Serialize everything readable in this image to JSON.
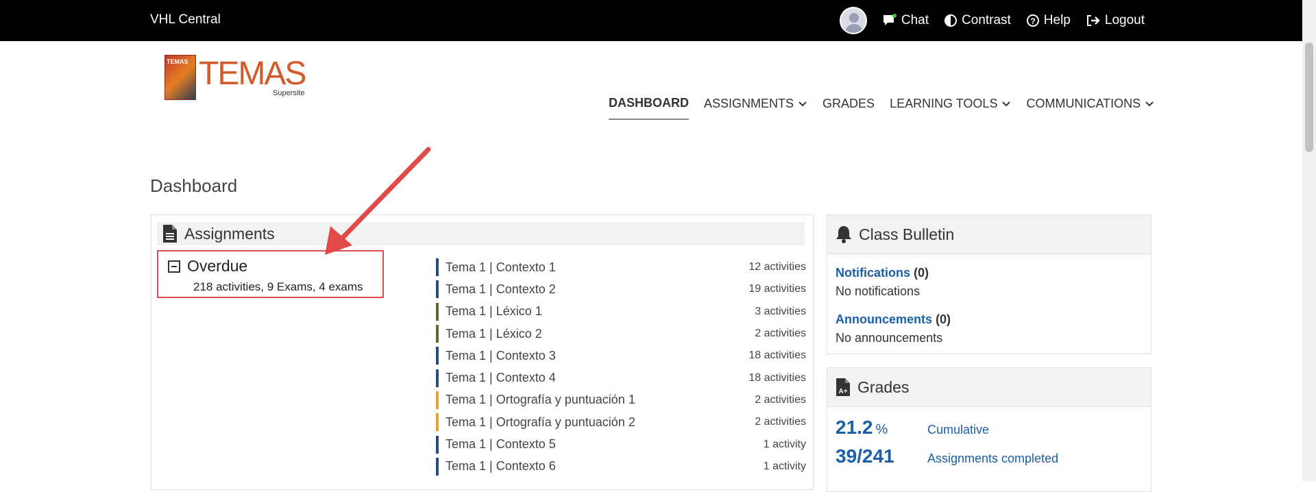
{
  "header": {
    "brand": "VHL Central",
    "nav": [
      {
        "label": "Chat",
        "icon": "chat-icon"
      },
      {
        "label": "Contrast",
        "icon": "contrast-icon"
      },
      {
        "label": "Help",
        "icon": "help-icon"
      },
      {
        "label": "Logout",
        "icon": "logout-icon"
      }
    ]
  },
  "logo": {
    "word": "TEMAS",
    "book_text": "TEMAS",
    "sub": "Supersite"
  },
  "main_nav": [
    {
      "label": "DASHBOARD",
      "active": true,
      "dropdown": false
    },
    {
      "label": "ASSIGNMENTS",
      "active": false,
      "dropdown": true
    },
    {
      "label": "GRADES",
      "active": false,
      "dropdown": false
    },
    {
      "label": "LEARNING TOOLS",
      "active": false,
      "dropdown": true
    },
    {
      "label": "COMMUNICATIONS",
      "active": false,
      "dropdown": true
    }
  ],
  "page_title": "Dashboard",
  "assignments": {
    "title": "Assignments",
    "overdue": {
      "title": "Overdue",
      "summary": "218 activities, 9 Exams, 4 exams"
    },
    "items": [
      {
        "name": "Tema 1 | Contexto 1",
        "count": "12 activities",
        "color": "#2a4a80"
      },
      {
        "name": "Tema 1 | Contexto 2",
        "count": "19 activities",
        "color": "#2a4a80"
      },
      {
        "name": "Tema 1 | Léxico 1",
        "count": "3 activities",
        "color": "#5a6e2a"
      },
      {
        "name": "Tema 1 | Léxico 2",
        "count": "2 activities",
        "color": "#5a6e2a"
      },
      {
        "name": "Tema 1 | Contexto 3",
        "count": "18 activities",
        "color": "#2a4a80"
      },
      {
        "name": "Tema 1 | Contexto 4",
        "count": "18 activities",
        "color": "#2a4a80"
      },
      {
        "name": "Tema 1 | Ortografía y puntuación 1",
        "count": "2 activities",
        "color": "#f0a030"
      },
      {
        "name": "Tema 1 | Ortografía y puntuación 2",
        "count": "2 activities",
        "color": "#f0a030"
      },
      {
        "name": "Tema 1 | Contexto 5",
        "count": "1 activity",
        "color": "#2a4a80"
      },
      {
        "name": "Tema 1 | Contexto 6",
        "count": "1 activity",
        "color": "#2a4a80"
      }
    ]
  },
  "bulletin": {
    "title": "Class Bulletin",
    "notifications_label": "Notifications",
    "notifications_count": "(0)",
    "notifications_empty": "No notifications",
    "announcements_label": "Announcements",
    "announcements_count": "(0)",
    "announcements_empty": "No announcements"
  },
  "grades": {
    "title": "Grades",
    "cumulative_value": "21.2",
    "cumulative_unit": "%",
    "cumulative_label": "Cumulative",
    "completed_value": "39/241",
    "completed_label": "Assignments completed"
  }
}
